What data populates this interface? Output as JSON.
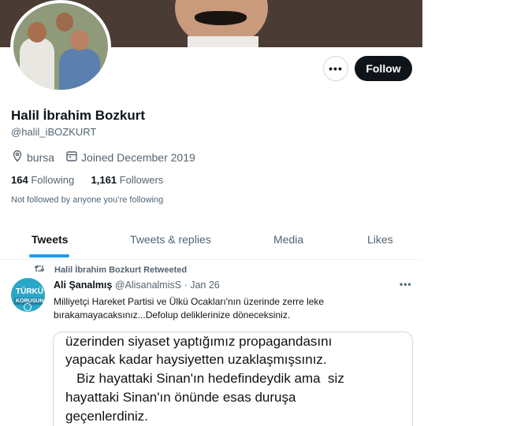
{
  "profile": {
    "name": "Halil İbrahim Bozkurt",
    "handle": "@halil_iBOZKURT",
    "location": "bursa",
    "joined": "Joined December 2019",
    "following_count": "164",
    "following_label": "Following",
    "followers_count": "1,161",
    "followers_label": "Followers",
    "not_followed": "Not followed by anyone you’re following"
  },
  "actions": {
    "more": "•••",
    "follow": "Follow"
  },
  "tabs": [
    {
      "label": "Tweets",
      "active": true
    },
    {
      "label": "Tweets & replies",
      "active": false
    },
    {
      "label": "Media",
      "active": false
    },
    {
      "label": "Likes",
      "active": false
    }
  ],
  "tweet": {
    "retweet_label": "Halil İbrahim Bozkurt Retweeted",
    "author_name": "Ali Şanalmış",
    "author_handle": "@AlisanalmisS",
    "separator": "·",
    "date": "Jan 26",
    "more": "•••",
    "text_line1": "Milliyetçi Hareket Partisi ve Ülkü Ocakları'nın üzerinde zerre leke",
    "text_line2": "bırakamayacaksınız...Defolup deliklerinize döneceksiniz.",
    "avatar_text1": "TÜRKÜ",
    "avatar_text2": "KORUSUN",
    "media_lines": [
      "üzerinden siyaset yaptığımız propagandasını",
      "yapacak kadar haysiyetten uzaklaşmışsınız.",
      "   Biz hayattaki Sinan'ın hedefindeydik ama  siz",
      "hayattaki Sinan'ın önünde esas duruşa",
      "geçenlerdiniz."
    ]
  },
  "colors": {
    "accent": "#1d9bf0",
    "text": "#0f1419",
    "muted": "#536471",
    "border": "#eff3f4"
  },
  "icons": [
    "location-icon",
    "calendar-icon",
    "retweet-icon",
    "more-icon"
  ]
}
